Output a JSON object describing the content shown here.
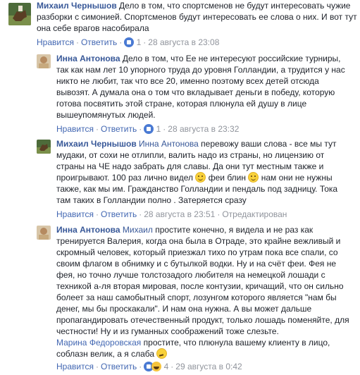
{
  "comments": [
    {
      "author": "Михаил Чернышов",
      "mention": "",
      "text": "Дело в том, что спортсменов не будут интересовать чужие разборки с симонией. Спортсменов будут интересовать ее слова о них. И вот тут она себе врагов насобирала",
      "like": "Нравится",
      "reply": "Ответить",
      "like_count": "1",
      "date": "28 августа в 23:08",
      "edited": "",
      "reaction_icons": [
        "like-icon"
      ]
    },
    {
      "author": "Инна Антонова",
      "mention": "",
      "text": "Дело в том, что Ее не интересуют российские турниры, так как нам лет 10 упорного труда до уровня Голландии, а трудится у нас никто не любит, так что все 20, именно поэтому всех детей отсюда вывозят. А думала она о том что вкладывает деньги в победу, которую готова посвятить этой стране, которая плюнула ей душу в лице вышеупомянутых людей.",
      "like": "Нравится",
      "reply": "Ответить",
      "like_count": "1",
      "date": "28 августа в 23:32",
      "edited": "",
      "reaction_icons": [
        "like-icon"
      ]
    },
    {
      "author": "Михаил Чернышов",
      "mention": "Инна Антонова",
      "text_part1": "перевожу ваши слова - все мы тут мудаки, от сохи не отлипли, валить надо из страны, но лицензию от страны на ЧЕ надо забрать для славы. Да они тут местным также и проигрывают. 100 раз лично видел",
      "text_part2": "феи блин",
      "text_part3": "нам они не нужны также, как мы им. Гражданство Голландии и пендаль под задницу. Тока там таких в Голландии полно . Затеряется сразу",
      "like": "Нравится",
      "reply": "Ответить",
      "date": "28 августа в 23:51",
      "edited": "Отредактирован"
    },
    {
      "author": "Инна Антонова",
      "mention": "Михаил",
      "text": "простите конечно, я видела и не раз как тренируется Валерия, когда она была в Отраде, это крайне вежливый и скромный человек, который приезжал тихо по утрам пока все спали, со своим флагом в обнимку и с бутылкой водки. Ну и на счёт феи. Фея не фея, но точно лучше толстозадого любителя на немецкой лошади с техникой а-ля вторая мировая, после контузии, кричащий, что он сильно болеет за наш самобытный спорт, лозунгом которого является \"нам бы денег, мы бы проскакали\". И нам она нужна. А вы может дальше пропагандировать отечественный продукт, только лошадь поменяйте, для честности! Ну и из гуманных соображений тоже слезьте.",
      "quote_name": "Марина Федоровская",
      "quote_text": "простите, что плюнула вашему клиенту в лицо, соблазн велик, а я слаба",
      "like": "Нравится",
      "reply": "Ответить",
      "like_count": "4",
      "date": "29 августа в 0:42",
      "edited": "",
      "reaction_icons": [
        "like-icon",
        "haha-icon"
      ]
    }
  ],
  "separator": "·",
  "colors": {
    "link": "#385898",
    "meta": "#90949c",
    "text": "#1d2129",
    "like": "#4a7ad3"
  }
}
